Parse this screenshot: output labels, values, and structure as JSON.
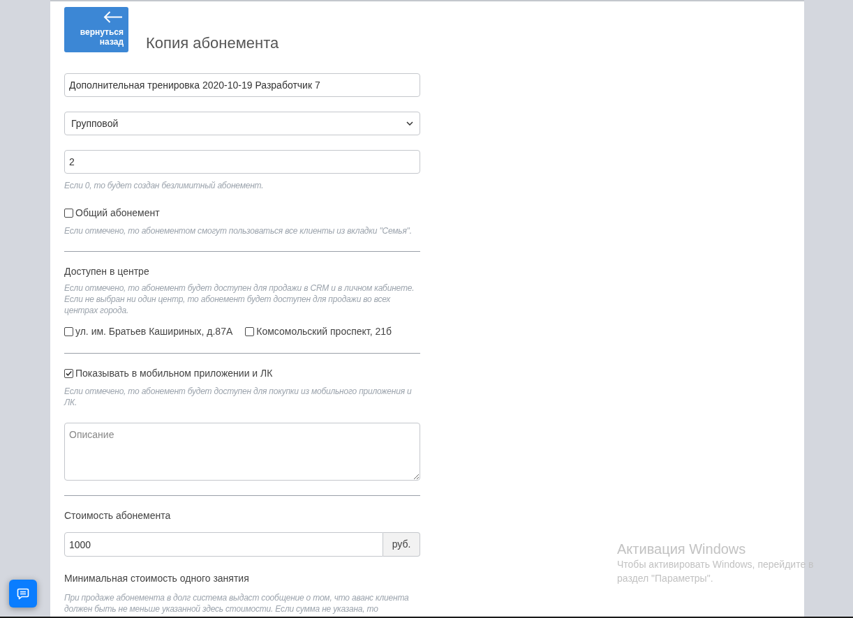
{
  "back_button": {
    "label": "вернуться назад"
  },
  "page_title": "Копия абонемента",
  "form": [
    {
      "kind": "input",
      "value": "Дополнительная тренировка 2020-10-19 Разработчик 7"
    },
    {
      "kind": "select",
      "value": "Групповой"
    },
    {
      "kind": "input",
      "value": "2",
      "hint": "Если 0, то будет создан безлимитный абонемент."
    },
    {
      "kind": "checkbox",
      "label": "Общий абонемент",
      "checked": false,
      "hint": "Если отмечено, то абонементом смогут пользоваться все клиенты из вкладки \"Семья\"."
    },
    {
      "kind": "divider"
    },
    {
      "kind": "checkbox_group",
      "label": "Доступен в центре",
      "hint": "Если отмечено, то абонемент будет доступен для продажи в CRM и в личном кабинете. Если не выбран ни один центр, то абонемент будет доступен для продажи во всех центрах города.",
      "options": [
        {
          "label": "ул. им. Братьев Кашириных, д.87А",
          "checked": false
        },
        {
          "label": "Комсомольский проспект, 21б",
          "checked": false
        }
      ]
    },
    {
      "kind": "divider"
    },
    {
      "kind": "checkbox",
      "label": "Показывать в мобильном приложении и ЛК",
      "checked": true,
      "hint": "Если отмечено, то абонемент будет доступен для покупки из мобильного приложения и ЛК."
    },
    {
      "kind": "textarea",
      "placeholder": "Описание"
    },
    {
      "kind": "divider"
    },
    {
      "kind": "input_group",
      "label": "Стоимость абонемента",
      "value": "1000",
      "addon": "руб."
    },
    {
      "kind": "note",
      "label": "Минимальная стоимость одного занятия",
      "hint": "При продаже абонемента в долг система выдаст сообщение о том, что аванс клиента должен быть не меньше указанной здесь стоимости. Если сумма не указана, то"
    }
  ],
  "system_notice": {
    "title": "Активация Windows",
    "text": "Чтобы активировать Windows, перейдите в раздел \"Параметры\"."
  }
}
